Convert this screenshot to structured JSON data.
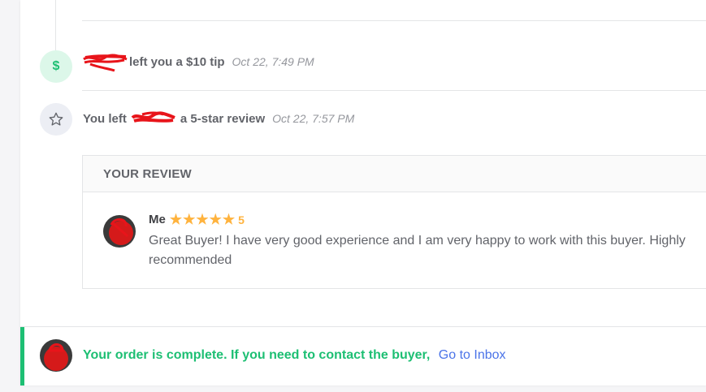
{
  "timeline": {
    "tip_event": {
      "text": "left you a $10 tip",
      "time": "Oct 22, 7:49 PM",
      "icon": "dollar-icon",
      "icon_glyph": "$"
    },
    "review_event": {
      "prefix": "You left",
      "suffix": "a 5-star review",
      "time": "Oct 22, 7:57 PM",
      "icon": "star-outline-icon"
    }
  },
  "review": {
    "header": "YOUR REVIEW",
    "reviewer": "Me",
    "stars": 5,
    "rating_label": "5",
    "text": "Great Buyer! I have very good experience and I am very happy to work with this buyer. Highly recommended"
  },
  "completion": {
    "message": "Your order is complete. If you need to contact the buyer,",
    "link_label": "Go to Inbox"
  },
  "colors": {
    "accent_green": "#1dbf73",
    "star": "#ffb33e",
    "link": "#4a73e8"
  }
}
